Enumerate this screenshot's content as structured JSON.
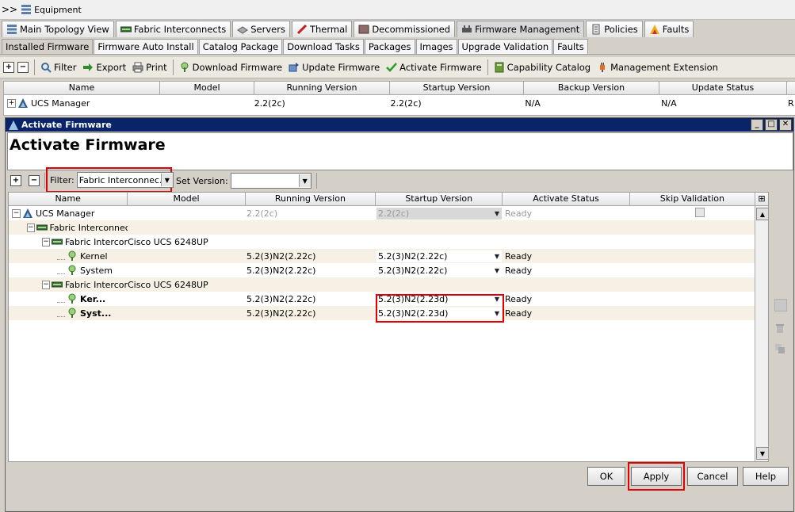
{
  "window": {
    "title": "Equipment"
  },
  "main_tabs": [
    {
      "label": "Main Topology View",
      "icon": "topology-icon"
    },
    {
      "label": "Fabric Interconnects",
      "icon": "fabric-interconnect-icon"
    },
    {
      "label": "Servers",
      "icon": "server-icon"
    },
    {
      "label": "Thermal",
      "icon": "thermometer-icon"
    },
    {
      "label": "Decommissioned",
      "icon": "decommissioned-icon"
    },
    {
      "label": "Firmware Management",
      "icon": "firmware-icon"
    },
    {
      "label": "Policies",
      "icon": "policies-icon"
    },
    {
      "label": "Faults",
      "icon": "faults-icon"
    }
  ],
  "sub_tabs": [
    "Installed Firmware",
    "Firmware Auto Install",
    "Catalog Package",
    "Download Tasks",
    "Packages",
    "Images",
    "Upgrade Validation",
    "Faults"
  ],
  "toolbar": {
    "filter": "Filter",
    "export": "Export",
    "print": "Print",
    "download_firmware": "Download Firmware",
    "update_firmware": "Update Firmware",
    "activate_firmware": "Activate Firmware",
    "capability_catalog": "Capability Catalog",
    "management_extension": "Management Extension"
  },
  "installed_table": {
    "headers": [
      "Name",
      "Model",
      "Running Version",
      "Startup Version",
      "Backup Version",
      "Update Status"
    ],
    "row": {
      "expander": "+",
      "name": "UCS Manager",
      "model": "",
      "running": "2.2(2c)",
      "startup": "2.2(2c)",
      "backup": "N/A",
      "update_status": "N/A",
      "overflow": "R"
    }
  },
  "dialog": {
    "title": "Activate Firmware",
    "header_title": "Activate Firmware",
    "filter_label": "Filter:",
    "filter_value": "Fabric Interconnec...",
    "set_version_label": "Set Version:",
    "set_version_value": "",
    "tree_headers": [
      "Name",
      "Model",
      "Running Version",
      "Startup Version",
      "Activate Status",
      "Skip Validation"
    ],
    "rows": [
      {
        "indent": 0,
        "expander": "−",
        "icon": "ucs-manager-icon",
        "name": "UCS Manager",
        "model": "",
        "running": "2.2(2c)",
        "startup": "2.2(2c)",
        "status": "Ready",
        "skip": true,
        "disabled": true
      },
      {
        "indent": 1,
        "expander": "−",
        "icon": "fabric-interconnect-icon",
        "name": "Fabric Interconnec",
        "model": "",
        "running": "",
        "startup": "",
        "status": "",
        "skip": false
      },
      {
        "indent": 2,
        "expander": "−",
        "icon": "fabric-interconnect-icon",
        "name": "Fabric Intercor",
        "model": "Cisco UCS 6248UP",
        "running": "",
        "startup": "",
        "status": "",
        "skip": false
      },
      {
        "indent": 3,
        "expander": "",
        "icon": "firmware-component-icon",
        "name": "Kernel",
        "model": "",
        "running": "5.2(3)N2(2.22c)",
        "startup": "5.2(3)N2(2.22c)",
        "status": "Ready",
        "skip": false
      },
      {
        "indent": 3,
        "expander": "",
        "icon": "firmware-component-icon",
        "name": "System",
        "model": "",
        "running": "5.2(3)N2(2.22c)",
        "startup": "5.2(3)N2(2.22c)",
        "status": "Ready",
        "skip": false
      },
      {
        "indent": 2,
        "expander": "−",
        "icon": "fabric-interconnect-icon",
        "name": "Fabric Intercor",
        "model": "Cisco UCS 6248UP",
        "running": "",
        "startup": "",
        "status": "",
        "skip": false
      },
      {
        "indent": 3,
        "expander": "",
        "icon": "firmware-component-icon",
        "name": "Ker...",
        "model": "",
        "running": "5.2(3)N2(2.22c)",
        "startup": "5.2(3)N2(2.23d)",
        "status": "Ready",
        "skip": false,
        "bold": true
      },
      {
        "indent": 3,
        "expander": "",
        "icon": "firmware-component-icon",
        "name": "Syst...",
        "model": "",
        "running": "5.2(3)N2(2.22c)",
        "startup": "5.2(3)N2(2.23d)",
        "status": "Ready",
        "skip": false,
        "bold": true
      }
    ],
    "buttons": {
      "ok": "OK",
      "apply": "Apply",
      "cancel": "Cancel",
      "help": "Help"
    }
  },
  "colors": {
    "dialog_title_bg": "#0a246a",
    "highlight_red": "#e00000",
    "alt_row": "#f6f1e4"
  }
}
